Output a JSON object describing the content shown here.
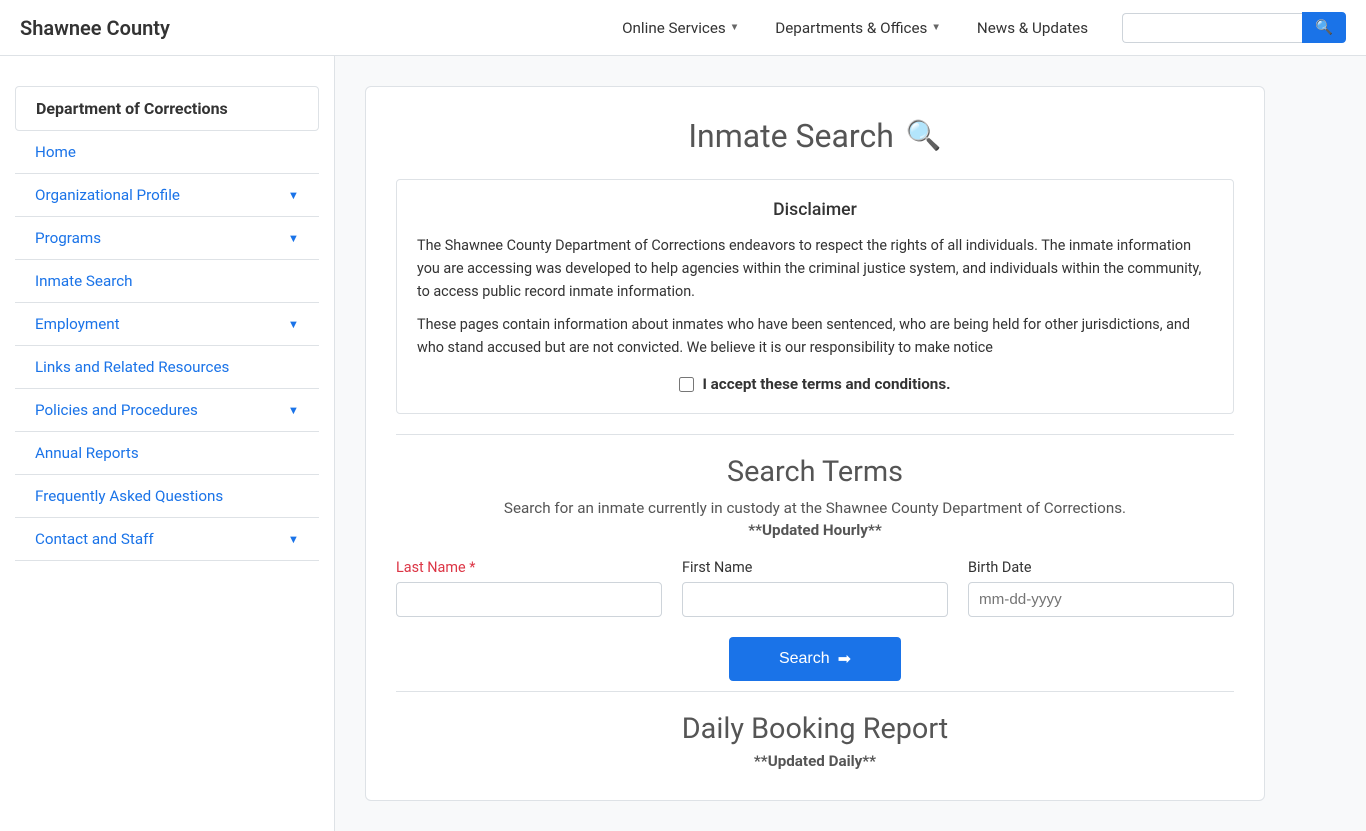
{
  "navbar": {
    "brand": "Shawnee County",
    "links": [
      {
        "label": "Online Services",
        "hasDropdown": true
      },
      {
        "label": "Departments & Offices",
        "hasDropdown": true
      },
      {
        "label": "News & Updates",
        "hasDropdown": false
      }
    ],
    "search_placeholder": ""
  },
  "sidebar": {
    "title": "Department of Corrections",
    "items": [
      {
        "label": "Home",
        "hasDropdown": false
      },
      {
        "label": "Organizational Profile",
        "hasDropdown": true
      },
      {
        "label": "Programs",
        "hasDropdown": true
      },
      {
        "label": "Inmate Search",
        "hasDropdown": false
      },
      {
        "label": "Employment",
        "hasDropdown": true
      },
      {
        "label": "Links and Related Resources",
        "hasDropdown": false
      },
      {
        "label": "Policies and Procedures",
        "hasDropdown": true
      },
      {
        "label": "Annual Reports",
        "hasDropdown": false
      },
      {
        "label": "Frequently Asked Questions",
        "hasDropdown": false
      },
      {
        "label": "Contact and Staff",
        "hasDropdown": true
      }
    ]
  },
  "page": {
    "title": "Inmate Search",
    "disclaimer": {
      "heading": "Disclaimer",
      "paragraph1": "The Shawnee County Department of Corrections endeavors to respect the rights of all individuals. The inmate information you are accessing was developed to help agencies within the criminal justice system, and individuals within the community, to access public record inmate information.",
      "paragraph2": "These pages contain information about inmates who have been sentenced, who are being held for other jurisdictions, and who stand accused but are not convicted. We believe it is our responsibility to make notice",
      "accept_label": "I accept these terms and conditions."
    },
    "search_terms": {
      "heading": "Search Terms",
      "subtitle": "Search for an inmate currently in custody at the Shawnee County Department of Corrections.",
      "updated": "**Updated Hourly**",
      "last_name_label": "Last Name",
      "last_name_required": "*",
      "first_name_label": "First Name",
      "birth_date_label": "Birth Date",
      "birth_date_placeholder": "mm-dd-yyyy",
      "search_button": "Search"
    },
    "daily_booking": {
      "heading": "Daily Booking Report",
      "updated": "**Updated Daily**"
    }
  }
}
